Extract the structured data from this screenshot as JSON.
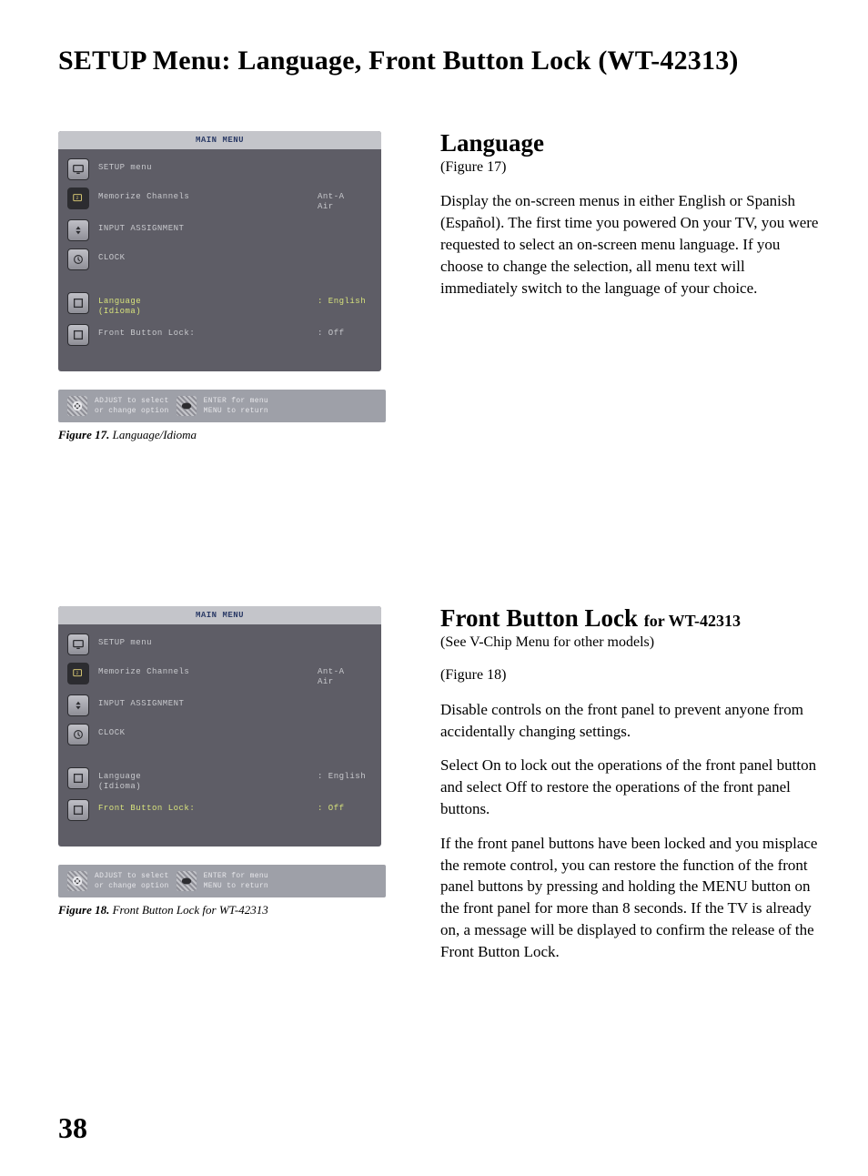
{
  "page_title": "SETUP Menu: Language, Front Button Lock (WT-42313)",
  "page_number": "38",
  "osd_title": "MAIN MENU",
  "osd_items": {
    "setup": {
      "label": "SETUP menu"
    },
    "mem": {
      "label": "Memorize Channels",
      "value": "Ant-A\nAir"
    },
    "input": {
      "label": "INPUT ASSIGNMENT"
    },
    "clock": {
      "label": "CLOCK"
    },
    "lang": {
      "label": "Language\n(Idioma)",
      "value": ": English"
    },
    "lock": {
      "label": "Front Button Lock:",
      "value": ": Off"
    }
  },
  "osd_footer": {
    "l1": "ADJUST to select",
    "l2": "or change option",
    "r1": "ENTER for menu",
    "r2": "MENU  to return"
  },
  "fig17_caption_bold": "Figure 17.",
  "fig17_caption_rest": " Language/Idioma",
  "fig18_caption_bold": "Figure 18.",
  "fig18_caption_rest": " Front Button Lock for WT-42313",
  "section_language": {
    "heading": "Language",
    "ref": "(Figure 17)",
    "p1": "Display the on-screen menus in either English or Spanish (Español).  The first time you powered On your TV, you were requested to select an on-screen menu language.  If you choose to change the selection, all menu text will immediately switch to the language of your choice."
  },
  "section_lock": {
    "heading": "Front Button Lock ",
    "heading_small": "for WT-42313",
    "subref1": "(See V-Chip Menu for other models)",
    "subref2": "(Figure 18)",
    "p1": "Disable controls on the front panel to prevent anyone from accidentally changing settings.",
    "p2": "Select On to lock out the operations of the front panel button and select Off to restore the operations of the front panel buttons.",
    "p3": "If the front panel buttons have been locked and you misplace the remote control, you can restore the function of the front panel buttons by pressing and holding the MENU button on the front panel  for more than 8 seconds.  If the TV is already on, a message will be displayed to confirm the release of the Front Button Lock."
  }
}
